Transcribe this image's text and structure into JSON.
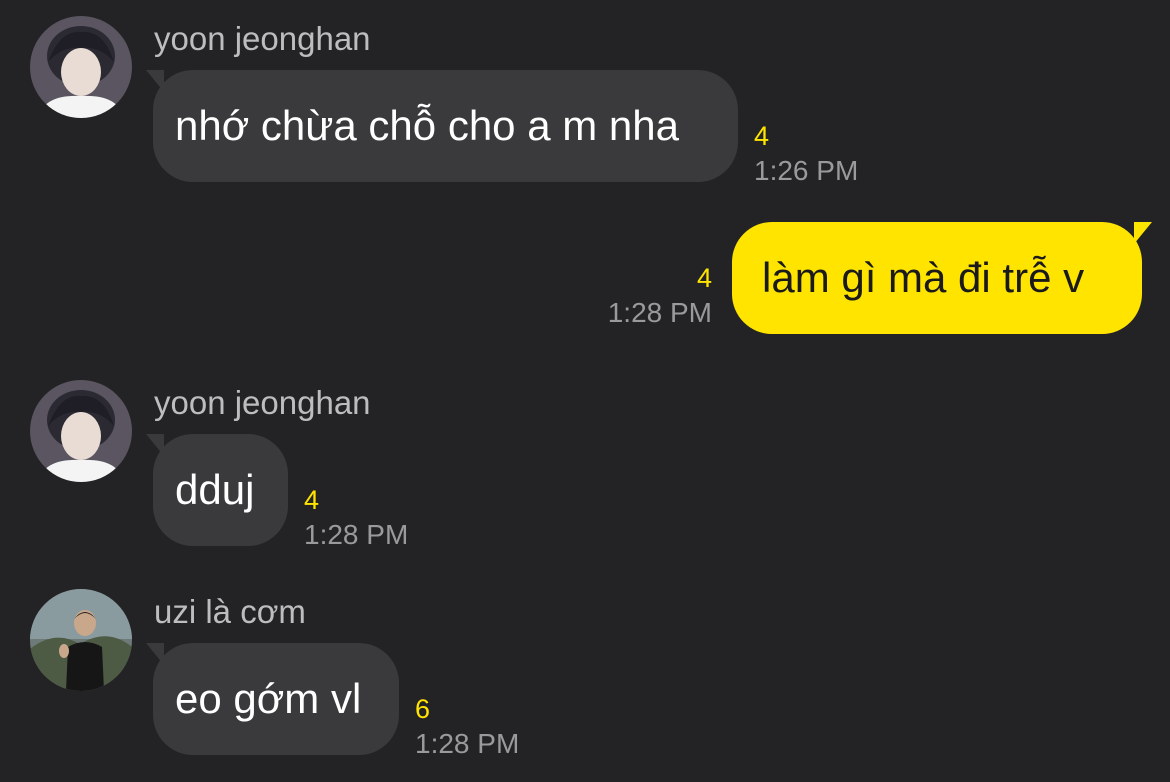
{
  "colors": {
    "background": "#232325",
    "incoming_bubble": "#3a3a3c",
    "outgoing_bubble": "#ffe400",
    "unread_count": "#ffe400",
    "timestamp": "#9a9a9d",
    "sender_name": "#bdbdbf"
  },
  "messages": [
    {
      "direction": "incoming",
      "sender": "yoon jeonghan",
      "avatar_icon": "profile-photo-avatar",
      "text": "nhớ chừa chỗ cho a m nha",
      "unread": "4",
      "time": "1:26 PM"
    },
    {
      "direction": "outgoing",
      "text": "làm gì mà đi trễ v",
      "unread": "4",
      "time": "1:28 PM"
    },
    {
      "direction": "incoming",
      "sender": "yoon jeonghan",
      "avatar_icon": "profile-photo-avatar",
      "text": "dduj",
      "unread": "4",
      "time": "1:28 PM"
    },
    {
      "direction": "incoming",
      "sender": "uzi là cơm",
      "avatar_icon": "profile-photo-avatar",
      "text": "eo gớm vl",
      "unread": "6",
      "time": "1:28 PM"
    }
  ]
}
